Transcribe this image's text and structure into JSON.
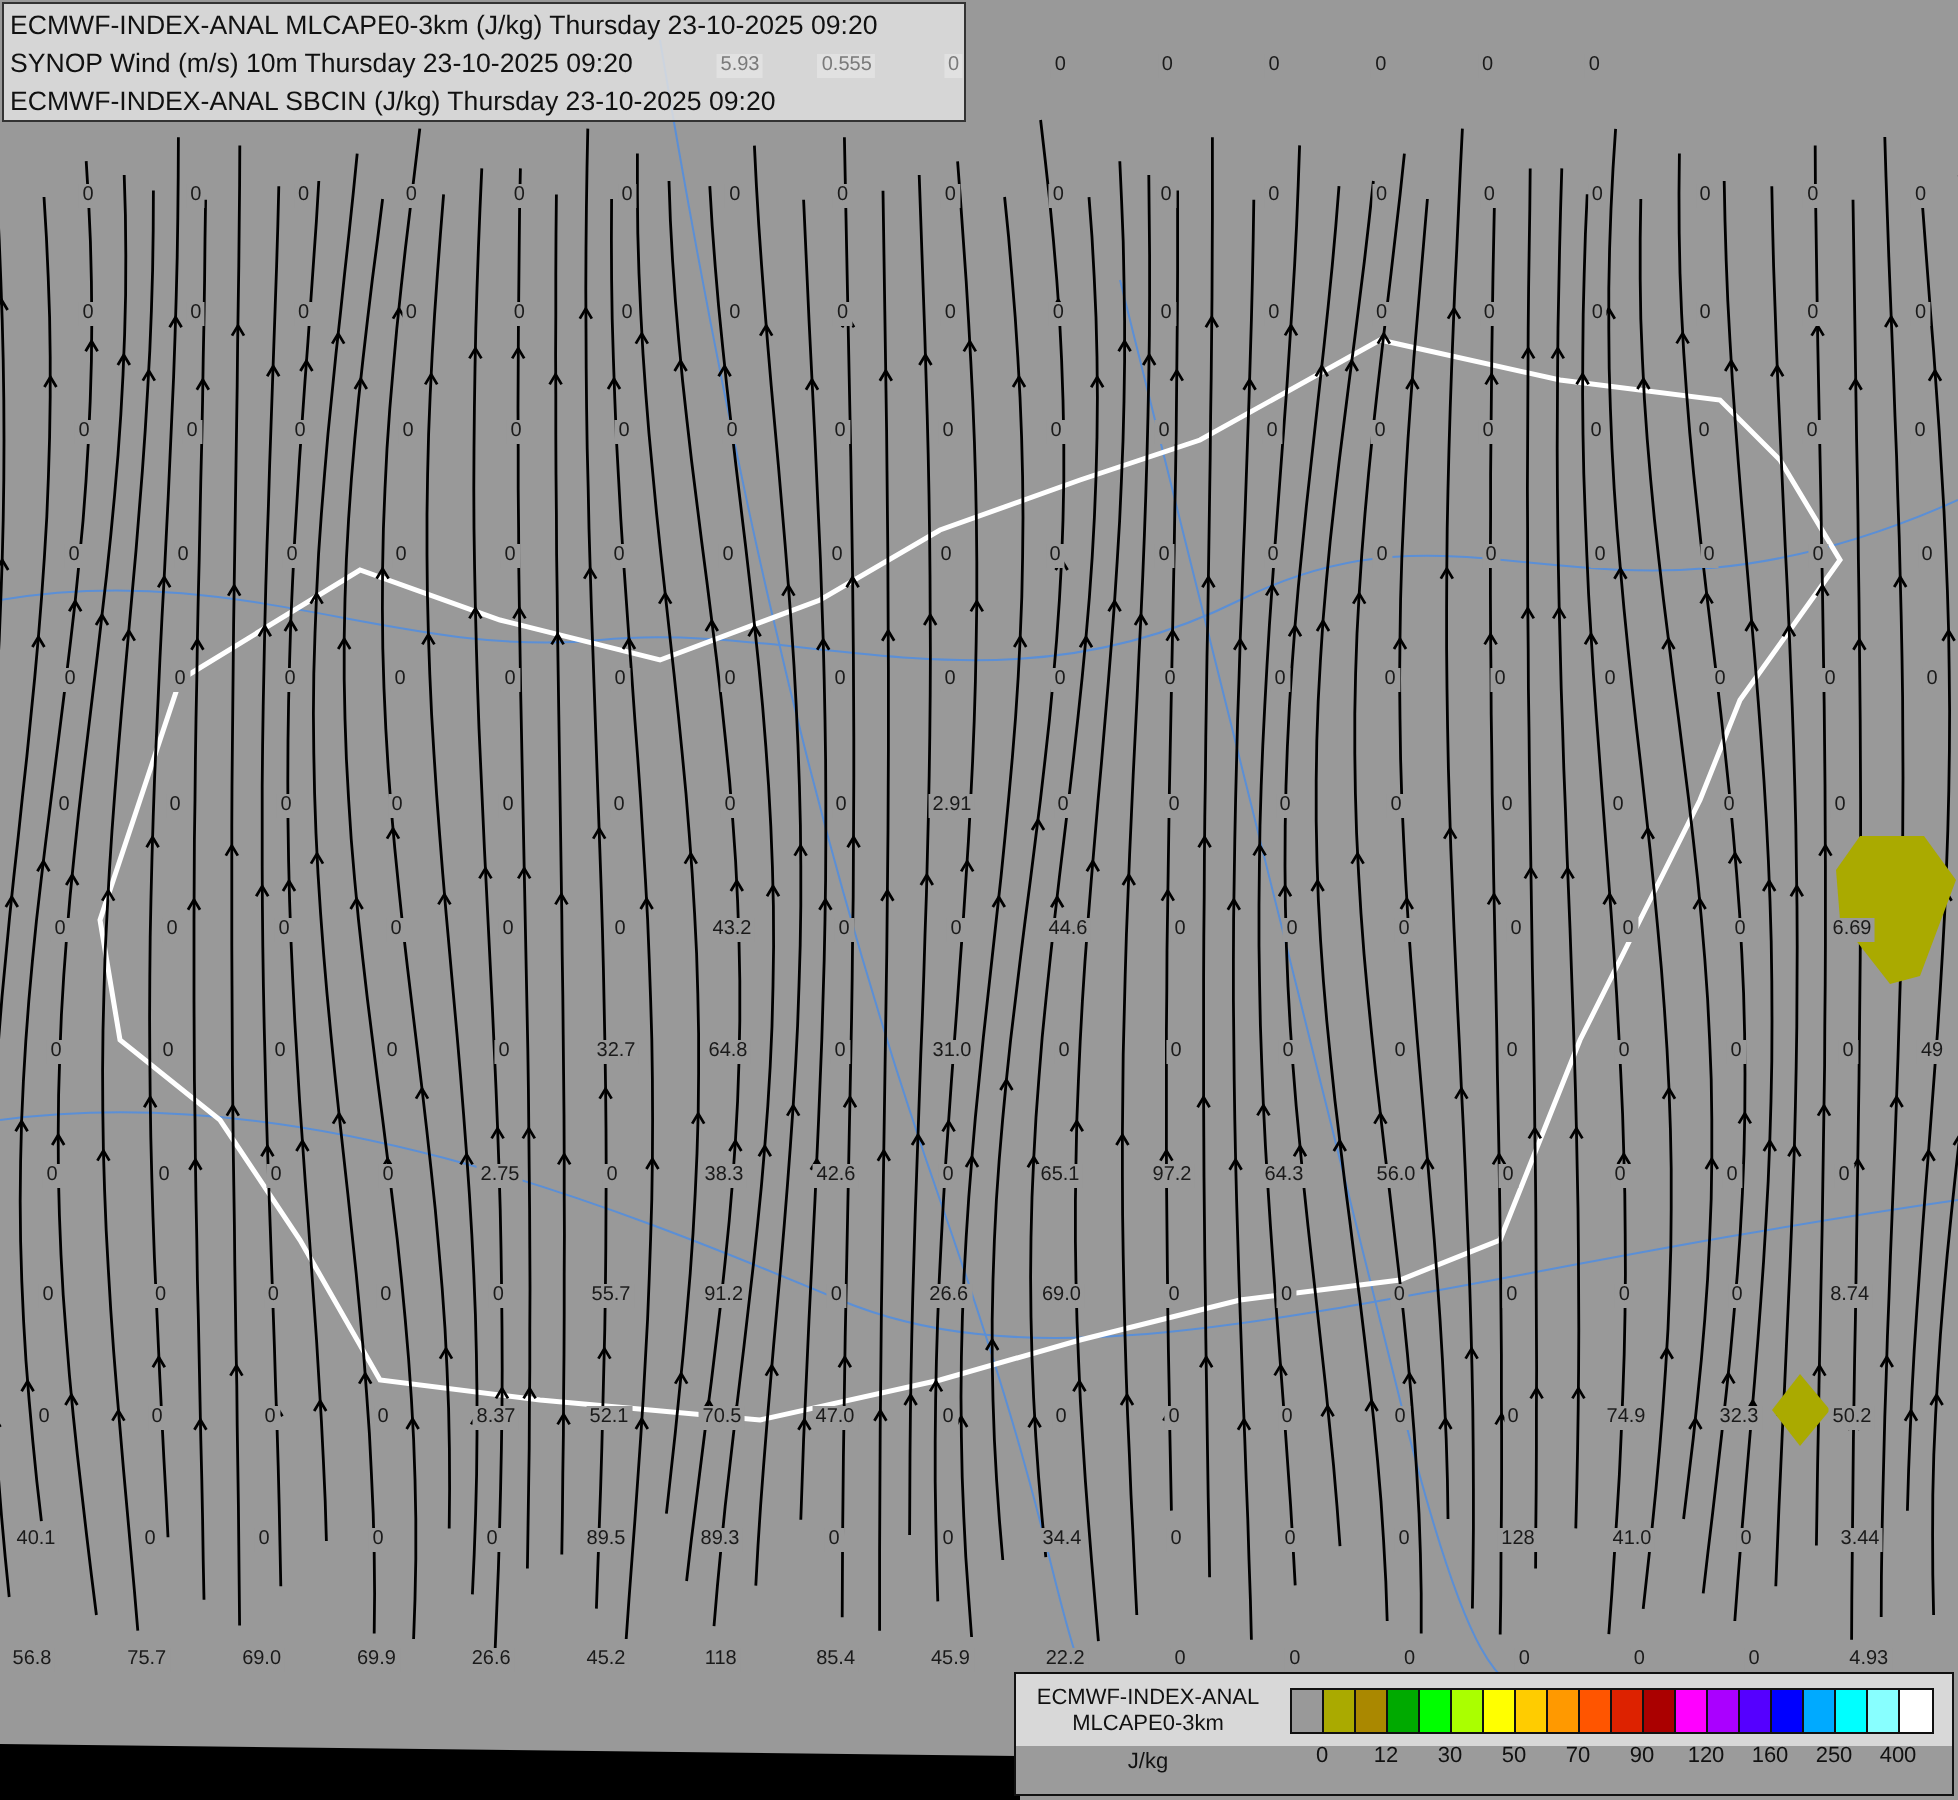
{
  "header": {
    "lines": [
      "ECMWF-INDEX-ANAL MLCAPE0-3km (J/kg) Thursday 23-10-2025 09:20",
      "SYNOP Wind (m/s) 10m Thursday 23-10-2025 09:20",
      "ECMWF-INDEX-ANAL SBCIN (J/kg) Thursday 23-10-2025 09:20"
    ]
  },
  "map": {
    "label_rows": [
      [
        "5.93",
        "0.555",
        "0",
        "0",
        "0",
        "0",
        "0",
        "0",
        "0"
      ],
      [
        "0",
        "0",
        "0",
        "0",
        "0",
        "0",
        "0",
        "0",
        "0",
        "0",
        "0",
        "0",
        "0",
        "0",
        "0",
        "0",
        "0",
        "0"
      ],
      [
        "0",
        "0",
        "0",
        "0",
        "0",
        "0",
        "0",
        "0",
        "0",
        "0",
        "0",
        "0",
        "0",
        "0",
        "0",
        "0",
        "0",
        "0"
      ],
      [
        "0",
        "0",
        "0",
        "0",
        "0",
        "0",
        "0",
        "0",
        "0",
        "0",
        "0",
        "0",
        "0",
        "0",
        "0",
        "0",
        "0",
        "0"
      ],
      [
        "0",
        "0",
        "0",
        "0",
        "0",
        "0",
        "0",
        "0",
        "0",
        "0",
        "0",
        "0",
        "0",
        "0",
        "0",
        "0",
        "0",
        "0"
      ],
      [
        "0",
        "0",
        "0",
        "0",
        "0",
        "0",
        "0",
        "0",
        "0",
        "0",
        "0",
        "0",
        "0",
        "0",
        "0",
        "0",
        "0",
        "0"
      ],
      [
        "0",
        "0",
        "0",
        "0",
        "0",
        "0",
        "0",
        "0",
        "2.91",
        "0",
        "0",
        "0",
        "0",
        "0",
        "0",
        "0",
        "0"
      ],
      [
        "0",
        "0",
        "0",
        "0",
        "0",
        "0",
        "43.2",
        "0",
        "0",
        "44.6",
        "0",
        "0",
        "0",
        "0",
        "0",
        "0",
        "6.69"
      ],
      [
        "0",
        "0",
        "0",
        "0",
        "0",
        "32.7",
        "64.8",
        "0",
        "31.0",
        "0",
        "0",
        "0",
        "0",
        "0",
        "0",
        "0",
        "0",
        "49"
      ],
      [
        "0",
        "0",
        "0",
        "0",
        "2.75",
        "0",
        "38.3",
        "42.6",
        "0",
        "65.1",
        "97.2",
        "64.3",
        "56.0",
        "0",
        "0",
        "0",
        "0"
      ],
      [
        "0",
        "0",
        "0",
        "0",
        "0",
        "55.7",
        "91.2",
        "0",
        "26.6",
        "69.0",
        "0",
        "0",
        "0",
        "0",
        "0",
        "0",
        "8.74"
      ],
      [
        "0",
        "0",
        "0",
        "0",
        "8.37",
        "52.1",
        "70.5",
        "47.0",
        "0",
        "0",
        "0",
        "0",
        "0",
        "0",
        "74.9",
        "32.3",
        "50.2"
      ],
      [
        "40.1",
        "0",
        "0",
        "0",
        "0",
        "89.5",
        "89.3",
        "0",
        "0",
        "34.4",
        "0",
        "0",
        "0",
        "128",
        "41.0",
        "0",
        "3.44"
      ],
      [
        "56.8",
        "75.7",
        "69.0",
        "69.9",
        "26.6",
        "45.2",
        "118",
        "85.4",
        "45.9",
        "22.2",
        "0",
        "0",
        "0",
        "0",
        "0",
        "0",
        "4.93"
      ]
    ]
  },
  "legend": {
    "title_lines": [
      "ECMWF-INDEX-ANAL",
      "MLCAPE0-3km"
    ],
    "unit": "J/kg",
    "swatches": [
      {
        "color": "#999999"
      },
      {
        "color": "#aaaa00"
      },
      {
        "color": "#aa8800"
      },
      {
        "color": "#00aa00"
      },
      {
        "color": "#00ff00"
      },
      {
        "color": "#aaff00"
      },
      {
        "color": "#ffff00"
      },
      {
        "color": "#ffcc00"
      },
      {
        "color": "#ff9900"
      },
      {
        "color": "#ff5500"
      },
      {
        "color": "#dd2200"
      },
      {
        "color": "#aa0000"
      },
      {
        "color": "#ff00ff"
      },
      {
        "color": "#aa00ff"
      },
      {
        "color": "#5500ff"
      },
      {
        "color": "#0000ff"
      },
      {
        "color": "#00aaff"
      },
      {
        "color": "#00ffff"
      },
      {
        "color": "#88ffff"
      },
      {
        "color": "#ffffff"
      }
    ],
    "ticks": [
      "0",
      "12",
      "30",
      "50",
      "70",
      "90",
      "120",
      "160",
      "250",
      "400"
    ]
  }
}
